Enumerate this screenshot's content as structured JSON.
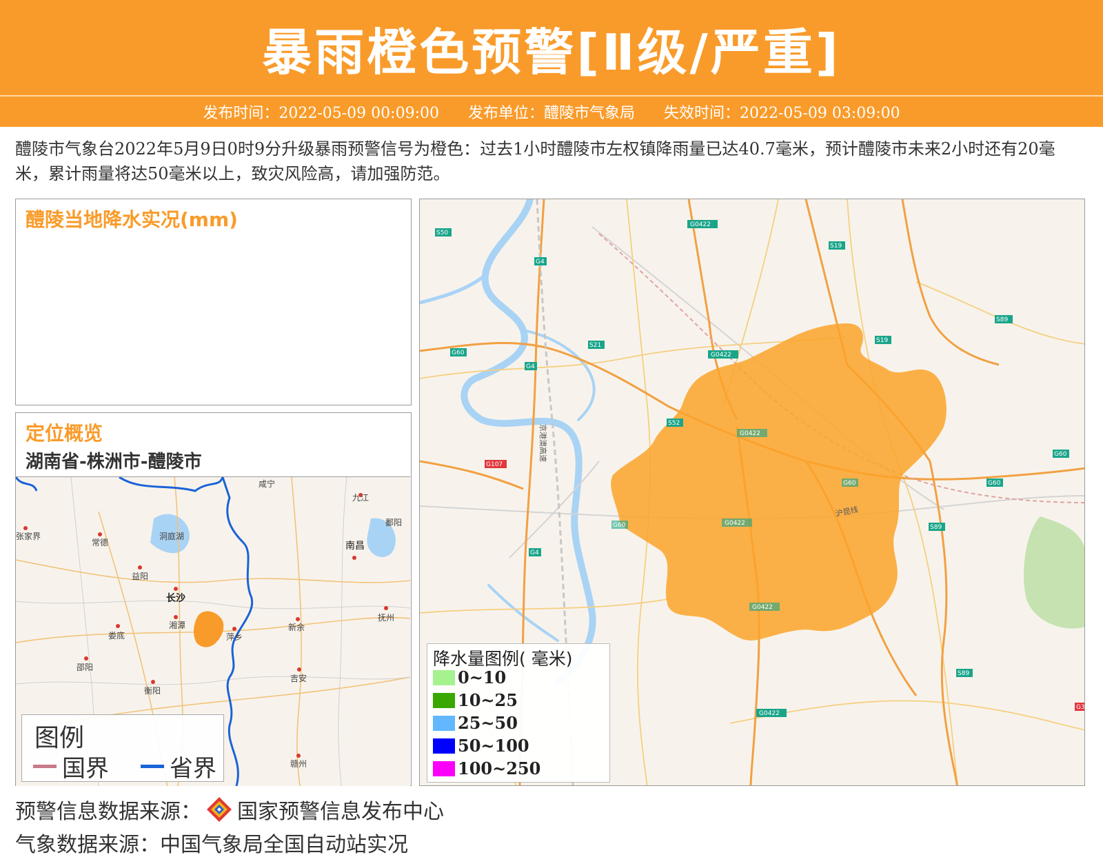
{
  "header": {
    "title": "暴雨橙色预警[Ⅱ级/严重]",
    "publish_time": "发布时间：2022-05-09 00:09:00",
    "publisher": "发布单位：醴陵市气象局",
    "expire_time": "失效时间：2022-05-09 03:09:00",
    "color": "#f99b2a"
  },
  "description": "醴陵市气象台2022年5月9日0时9分升级暴雨预警信号为橙色：过去1小时醴陵市左权镇降雨量已达40.7毫米，预计醴陵市未来2小时还有20毫米，累计雨量将达50毫米以上，致灾风险高，请加强防范。",
  "rain_panel": {
    "title": "醴陵当地降水实况(mm)"
  },
  "location_panel": {
    "title": "定位概览",
    "path": "湖南省-株洲市-醴陵市",
    "cities": [
      "咸宁",
      "九江",
      "张家界",
      "常德",
      "洞庭湖",
      "鄱阳",
      "南昌",
      "益阳",
      "长沙",
      "湘潭",
      "娄底",
      "萍乡",
      "新余",
      "抚州",
      "邵阳",
      "衡阳",
      "吉安",
      "赣州"
    ],
    "legend": {
      "title": "图例",
      "items": [
        {
          "label": "国界",
          "color": "#c97a8a"
        },
        {
          "label": "省界",
          "color": "#1a63d8"
        }
      ]
    }
  },
  "main_map": {
    "road_labels": [
      "S50",
      "G0422",
      "S19",
      "G4",
      "S89",
      "G60",
      "S21",
      "G0422",
      "S19",
      "G4",
      "S52",
      "G0422",
      "G107",
      "G60",
      "G60",
      "G60",
      "G60",
      "G0422",
      "S89",
      "G4",
      "G0422",
      "S89",
      "G0422",
      "G3"
    ],
    "rail_labels": [
      "京港澳高速",
      "沪昆线"
    ],
    "warning_area_color": "#fca32a",
    "legend": {
      "title": "降水量图例( 毫米)",
      "items": [
        {
          "label": "0~10",
          "color": "#a6f28f"
        },
        {
          "label": "10~25",
          "color": "#38a800"
        },
        {
          "label": "25~50",
          "color": "#61b8ff"
        },
        {
          "label": "50~100",
          "color": "#0000ff"
        },
        {
          "label": "100~250",
          "color": "#fa00fa"
        }
      ]
    }
  },
  "footer": {
    "source1_label": "预警信息数据来源：",
    "source1_name": "国家预警信息发布中心",
    "source2": "气象数据来源：中国气象局全国自动站实况"
  }
}
